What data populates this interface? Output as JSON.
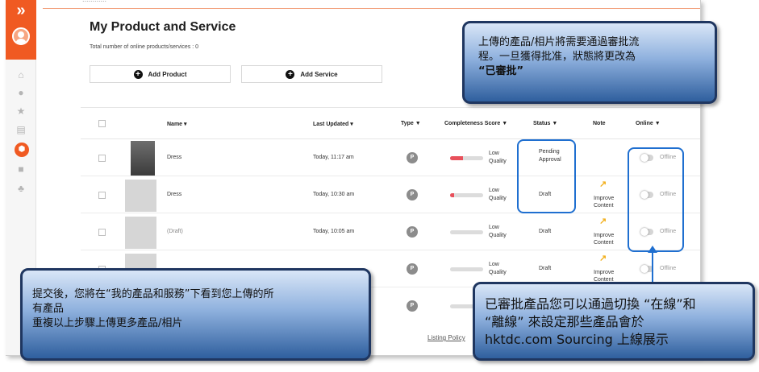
{
  "page": {
    "title": "My Product and Service",
    "subtitle": "Total number of online products/services : 0",
    "add_product": "Add Product",
    "add_service": "Add Service",
    "listing_policy": "Listing Policy",
    "top_clipped": "............"
  },
  "sidebar": {
    "toggle": "»",
    "icons": [
      "home-icon",
      "user-icon",
      "star-icon",
      "message-icon",
      "product-icon",
      "document-icon",
      "people-icon"
    ]
  },
  "table": {
    "headers": {
      "name": "Name",
      "last_updated": "Last Updated",
      "type": "Type",
      "completeness": "Completeness Score",
      "status": "Status",
      "note": "Note",
      "online": "Online"
    },
    "rows": [
      {
        "name": "Dress",
        "updated": "Today, 11:17 am",
        "type": "P",
        "quality_1": "Low",
        "quality_2": "Quality",
        "completeness": 0.38,
        "status_1": "Pending",
        "status_2": "Approval",
        "note_1": "",
        "note_2": "",
        "online": "Offline"
      },
      {
        "name": "Dress",
        "updated": "Today, 10:30 am",
        "type": "P",
        "quality_1": "Low",
        "quality_2": "Quality",
        "completeness": 0.12,
        "status_1": "Draft",
        "status_2": "",
        "note_1": "Improve",
        "note_2": "Content",
        "online": "Offline"
      },
      {
        "name": "(Draft)",
        "updated": "Today, 10:05 am",
        "type": "P",
        "quality_1": "Low",
        "quality_2": "Quality",
        "completeness": 0.0,
        "status_1": "Draft",
        "status_2": "",
        "note_1": "Improve",
        "note_2": "Content",
        "online": "Offline"
      },
      {
        "name": "",
        "updated": "",
        "type": "P",
        "quality_1": "Low",
        "quality_2": "Quality",
        "completeness": 0.0,
        "status_1": "Draft",
        "status_2": "",
        "note_1": "Improve",
        "note_2": "Content",
        "online": "Offline"
      },
      {
        "name": "",
        "updated": "",
        "type": "P",
        "quality_1": "",
        "quality_2": "",
        "completeness": 0.0,
        "status_1": "",
        "status_2": "",
        "note_1": "",
        "note_2": "",
        "online": ""
      }
    ]
  },
  "callouts": {
    "top_right_1": "上傳的產品/相片將需要通過審批流",
    "top_right_2": "程。一旦獲得批准，狀態將更改為",
    "top_right_3": "“已審批”",
    "bottom_left_1": "提交後，您將在“我的產品和服務”下看到您上傳的所",
    "bottom_left_2": "有產品",
    "bottom_left_3": "重複以上步驟上傳更多產品/相片",
    "bottom_right_1": "已審批產品您可以通過切換 “在線”和",
    "bottom_right_2": "“離線” 來設定那些產品會於",
    "bottom_right_3": "hktdc.com Sourcing 上線展示"
  }
}
